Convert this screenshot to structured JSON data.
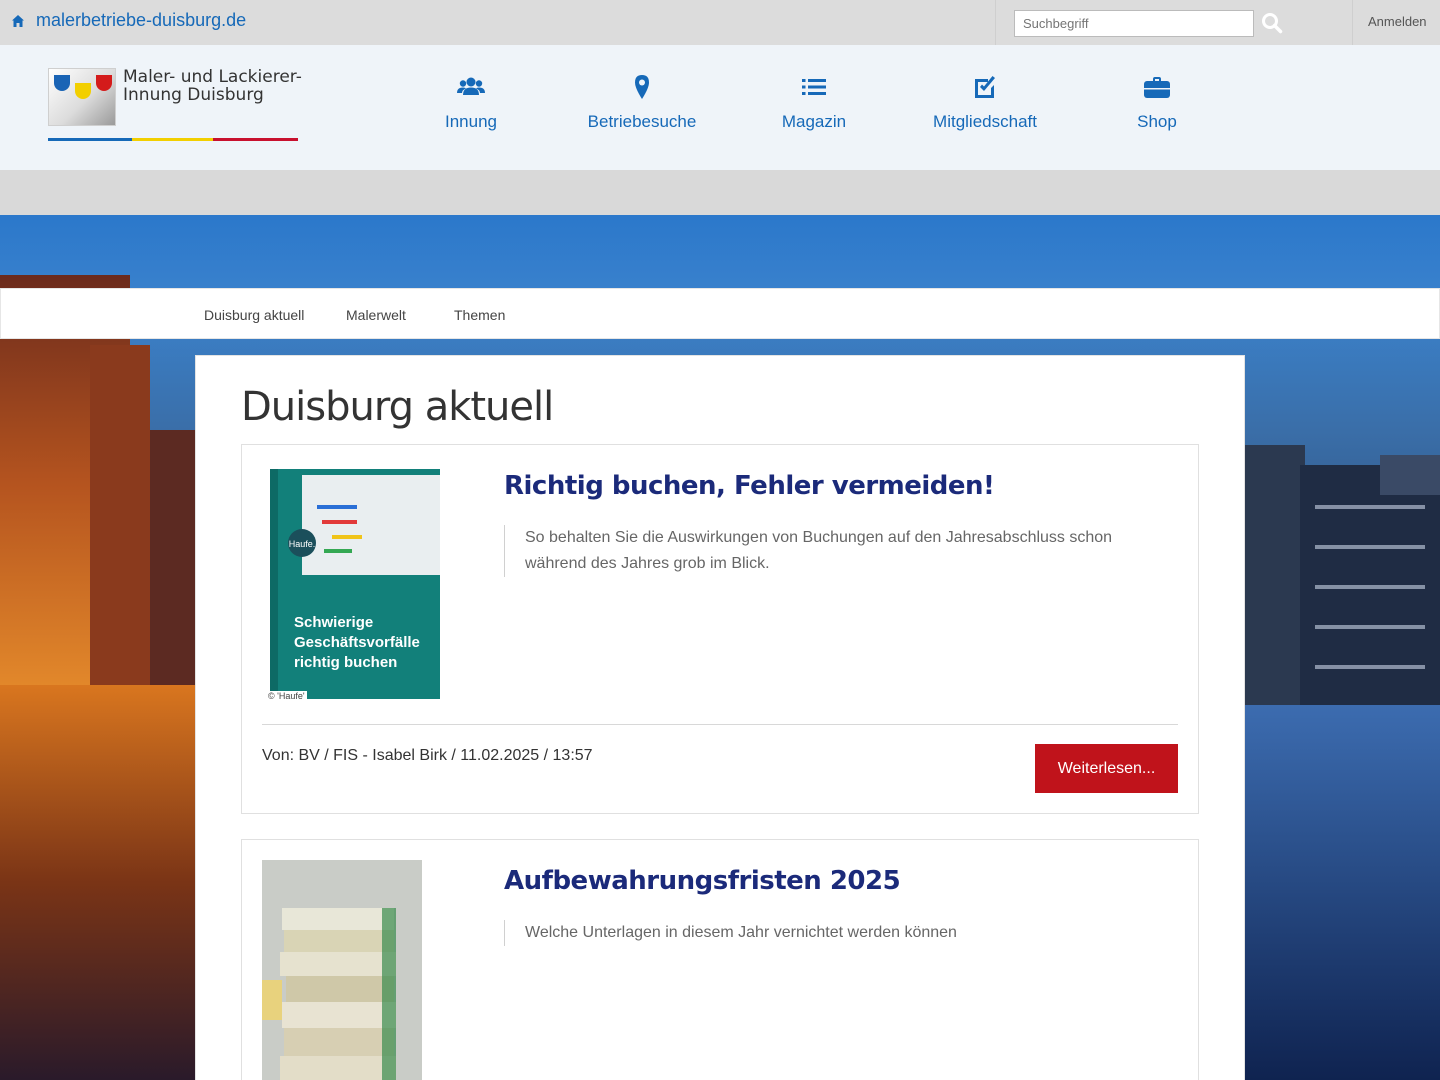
{
  "topbar": {
    "site_link": "malerbetriebe-duisburg.de",
    "search_placeholder": "Suchbegriff",
    "login_label": "Anmelden"
  },
  "logo": {
    "line1": "Maler- und Lackierer-",
    "line2": "Innung Duisburg"
  },
  "mainnav": [
    {
      "label": "Innung",
      "icon": "users-icon"
    },
    {
      "label": "Betriebesuche",
      "icon": "map-marker-icon"
    },
    {
      "label": "Magazin",
      "icon": "list-icon"
    },
    {
      "label": "Mitgliedschaft",
      "icon": "edit-check-icon"
    },
    {
      "label": "Shop",
      "icon": "briefcase-icon"
    }
  ],
  "subnav": [
    {
      "label": "Duisburg aktuell"
    },
    {
      "label": "Malerwelt"
    },
    {
      "label": "Themen"
    }
  ],
  "content": {
    "title": "Duisburg aktuell",
    "articles": [
      {
        "title": "Richtig buchen, Fehler vermeiden!",
        "teaser": "So behalten Sie die Auswirkungen von Buchungen auf den Jahresabschluss schon während des Jahres grob im Blick.",
        "meta": "Von: BV / FIS - Isabel Birk / 11.02.2025 / 13:57",
        "button": "Weiterlesen...",
        "image_credit": "© 'Haufe'",
        "book_brand": "Haufe.",
        "book_title_1": "Schwierige",
        "book_title_2": "Geschäftsvorfälle",
        "book_title_3": "richtig buchen"
      },
      {
        "title": "Aufbewahrungsfristen 2025",
        "teaser": "Welche Unterlagen in diesem Jahr vernichtet werden können"
      }
    ]
  },
  "colors": {
    "brand_blue": "#1669b8",
    "brand_yellow": "#f2cf00",
    "brand_red": "#c8102e",
    "button_red": "#c0131b",
    "title_navy": "#1b2a7a"
  }
}
